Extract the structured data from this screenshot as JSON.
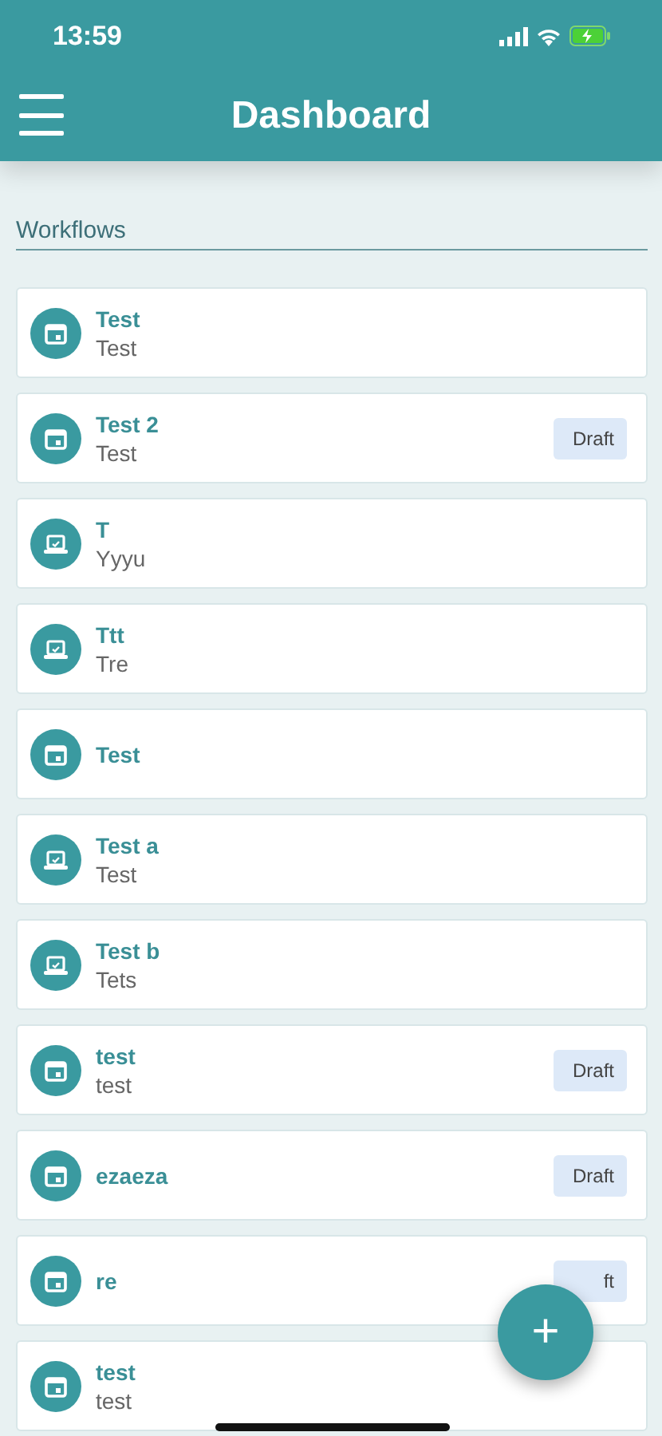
{
  "status_bar": {
    "time": "13:59"
  },
  "header": {
    "title": "Dashboard"
  },
  "section": {
    "title": "Workflows"
  },
  "workflows": [
    {
      "kind": "calendar",
      "title": "Test",
      "subtitle": "Test"
    },
    {
      "kind": "calendar",
      "title": "Test 2",
      "subtitle": "Test",
      "badge": "Draft"
    },
    {
      "kind": "laptop",
      "title": "T",
      "subtitle": "Yyyu"
    },
    {
      "kind": "laptop",
      "title": "Ttt",
      "subtitle": "Tre"
    },
    {
      "kind": "calendar",
      "title": "Test"
    },
    {
      "kind": "laptop",
      "title": "Test a",
      "subtitle": "Test"
    },
    {
      "kind": "laptop",
      "title": "Test b",
      "subtitle": "Tets"
    },
    {
      "kind": "calendar",
      "title": "test",
      "subtitle": "test",
      "badge": "Draft"
    },
    {
      "kind": "calendar",
      "title": "ezaeza",
      "badge": "Draft"
    },
    {
      "kind": "calendar",
      "title": "re",
      "badge": "ft"
    },
    {
      "kind": "calendar",
      "title": "test",
      "subtitle": "test"
    }
  ],
  "fab": {
    "label": "+"
  }
}
